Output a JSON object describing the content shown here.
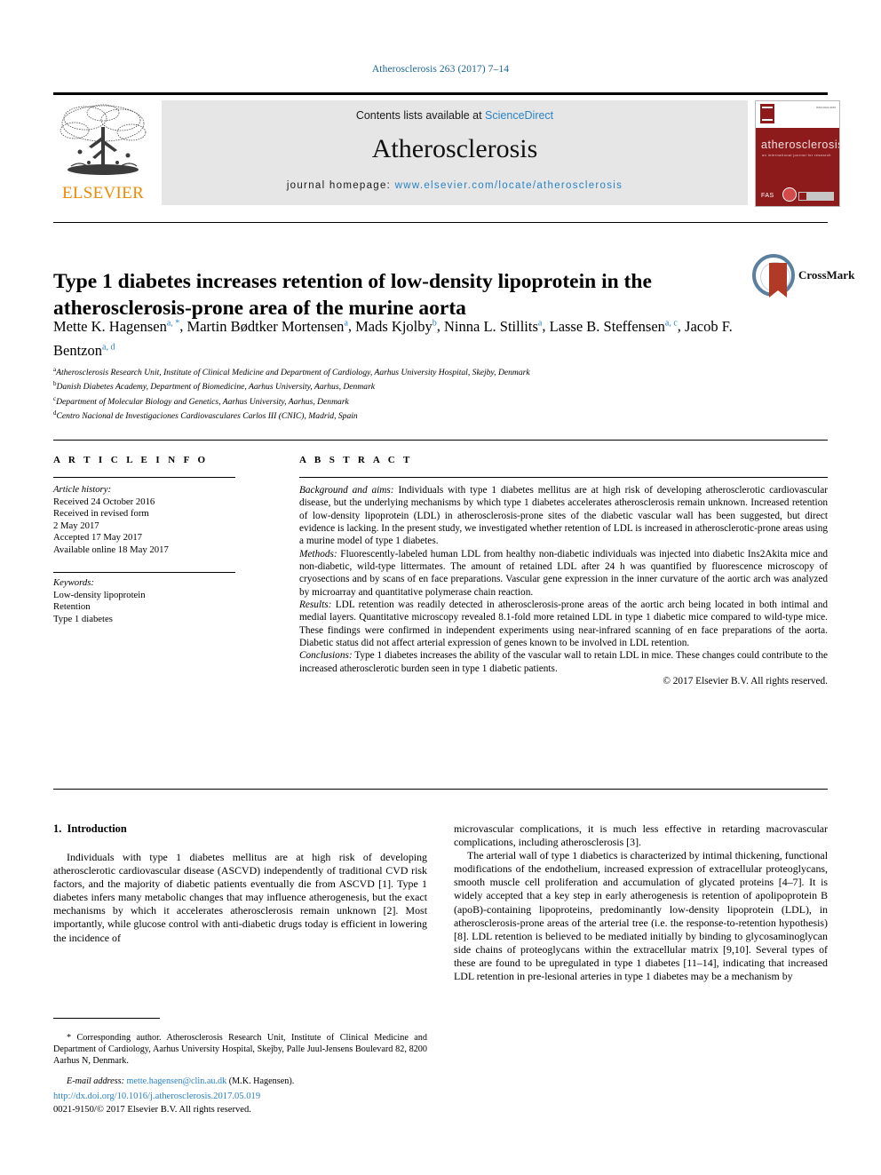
{
  "running_head": "Atherosclerosis 263 (2017) 7–14",
  "masthead": {
    "publisher": "ELSEVIER",
    "contents_prefix": "Contents lists available at ",
    "contents_link": "ScienceDirect",
    "journal_title": "Atherosclerosis",
    "homepage_label": "journal homepage: ",
    "homepage_url": "www.elsevier.com/locate/atherosclerosis",
    "cover": {
      "name": "atherosclerosis",
      "subtitle": "an international journal for research",
      "fas_label": "FAS",
      "corner_note": "ISSN 0021-9150"
    }
  },
  "article": {
    "title": "Type 1 diabetes increases retention of low-density lipoprotein in the atherosclerosis-prone area of the murine aorta",
    "crossmark_label": "CrossMark",
    "authors_line1": "Mette K. Hagensen",
    "authors": [
      {
        "name": "Mette K. Hagensen",
        "marks": "a, *"
      },
      {
        "name": "Martin Bødtker Mortensen",
        "marks": "a"
      },
      {
        "name": "Mads Kjolby",
        "marks": "b"
      },
      {
        "name": "Ninna L. Stillits",
        "marks": "a"
      },
      {
        "name": "Lasse B. Steffensen",
        "marks": "a, c"
      },
      {
        "name": "Jacob F. Bentzon",
        "marks": "a, d"
      }
    ],
    "affiliations": [
      {
        "mark": "a",
        "text": "Atherosclerosis Research Unit, Institute of Clinical Medicine and Department of Cardiology, Aarhus University Hospital, Skejby, Denmark"
      },
      {
        "mark": "b",
        "text": "Danish Diabetes Academy, Department of Biomedicine, Aarhus University, Aarhus, Denmark"
      },
      {
        "mark": "c",
        "text": "Department of Molecular Biology and Genetics, Aarhus University, Aarhus, Denmark"
      },
      {
        "mark": "d",
        "text": "Centro Nacional de Investigaciones Cardiovasculares Carlos III (CNIC), Madrid, Spain"
      }
    ]
  },
  "article_info": {
    "heading": "A R T I C L E   I N F O",
    "history_label": "Article history:",
    "history": [
      "Received 24 October 2016",
      "Received in revised form",
      "2 May 2017",
      "Accepted 17 May 2017",
      "Available online 18 May 2017"
    ],
    "keywords_label": "Keywords:",
    "keywords": [
      "Low-density lipoprotein",
      "Retention",
      "Type 1 diabetes"
    ]
  },
  "abstract": {
    "heading": "A B S T R A C T",
    "sections": [
      {
        "lead": "Background and aims:",
        "text": " Individuals with type 1 diabetes mellitus are at high risk of developing atherosclerotic cardiovascular disease, but the underlying mechanisms by which type 1 diabetes accelerates atherosclerosis remain unknown. Increased retention of low-density lipoprotein (LDL) in atherosclerosis-prone sites of the diabetic vascular wall has been suggested, but direct evidence is lacking. In the present study, we investigated whether retention of LDL is increased in atherosclerotic-prone areas using a murine model of type 1 diabetes."
      },
      {
        "lead": "Methods:",
        "text": " Fluorescently-labeled human LDL from healthy non-diabetic individuals was injected into diabetic Ins2Akita mice and non-diabetic, wild-type littermates. The amount of retained LDL after 24 h was quantified by fluorescence microscopy of cryosections and by scans of en face preparations. Vascular gene expression in the inner curvature of the aortic arch was analyzed by microarray and quantitative polymerase chain reaction."
      },
      {
        "lead": "Results:",
        "text": " LDL retention was readily detected in atherosclerosis-prone areas of the aortic arch being located in both intimal and medial layers. Quantitative microscopy revealed 8.1-fold more retained LDL in type 1 diabetic mice compared to wild-type mice. These findings were confirmed in independent experiments using near-infrared scanning of en face preparations of the aorta. Diabetic status did not affect arterial expression of genes known to be involved in LDL retention."
      },
      {
        "lead": "Conclusions:",
        "text": " Type 1 diabetes increases the ability of the vascular wall to retain LDL in mice. These changes could contribute to the increased atherosclerotic burden seen in type 1 diabetic patients."
      }
    ],
    "copyright": "© 2017 Elsevier B.V. All rights reserved."
  },
  "body": {
    "section_number": "1.",
    "section_title": "Introduction",
    "left_paragraphs": [
      "Individuals with type 1 diabetes mellitus are at high risk of developing atherosclerotic cardiovascular disease (ASCVD) independently of traditional CVD risk factors, and the majority of diabetic patients eventually die from ASCVD [1]. Type 1 diabetes infers many metabolic changes that may influence atherogenesis, but the exact mechanisms by which it accelerates atherosclerosis remain unknown [2]. Most importantly, while glucose control with anti-diabetic drugs today is efficient in lowering the incidence of"
    ],
    "right_paragraphs": [
      "microvascular complications, it is much less effective in retarding macrovascular complications, including atherosclerosis [3].",
      "The arterial wall of type 1 diabetics is characterized by intimal thickening, functional modifications of the endothelium, increased expression of extracellular proteoglycans, smooth muscle cell proliferation and accumulation of glycated proteins [4–7]. It is widely accepted that a key step in early atherogenesis is retention of apolipoprotein B (apoB)-containing lipoproteins, predominantly low-density lipoprotein (LDL), in atherosclerosis-prone areas of the arterial tree (i.e. the response-to-retention hypothesis) [8]. LDL retention is believed to be mediated initially by binding to glycosaminoglycan side chains of proteoglycans within the extracellular matrix [9,10]. Several types of these are found to be upregulated in type 1 diabetes [11–14], indicating that increased LDL retention in pre-lesional arteries in type 1 diabetes may be a mechanism by"
    ]
  },
  "footnote": {
    "corresponding": "* Corresponding author. Atherosclerosis Research Unit, Institute of Clinical Medicine and Department of Cardiology, Aarhus University Hospital, Skejby, Palle Juul-Jensens Boulevard 82, 8200 Aarhus N, Denmark.",
    "email_label": "E-mail address:",
    "email": "mette.hagensen@clin.au.dk",
    "email_owner": "(M.K. Hagensen).",
    "doi": "http://dx.doi.org/10.1016/j.atherosclerosis.2017.05.019",
    "issn_line": "0021-9150/© 2017 Elsevier B.V. All rights reserved."
  },
  "colors": {
    "link": "#2b82c4",
    "runhead": "#1a6496",
    "elsevier_orange": "#ed8b00",
    "cover_red": "#8e1b1b",
    "banner_grey": "#e6e6e6"
  }
}
